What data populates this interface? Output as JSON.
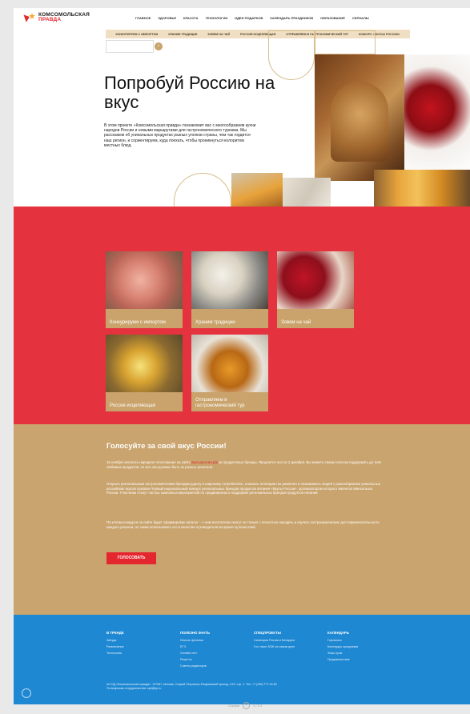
{
  "header": {
    "logo_line1": "Комсомольская",
    "logo_line2": "правда",
    "nav": [
      "Главное",
      "Здоровье",
      "Красота",
      "Технологии",
      "Идеи подарков",
      "Календарь праздников",
      "Образование",
      "Сериалы"
    ],
    "subnav": [
      "Конкурируем с импортом",
      "Храним традиции",
      "Зовем на чай",
      "Россия исцеляющая",
      "Отправляем в гастрономический тур",
      "Конкурс «Вкусы России»"
    ]
  },
  "hero": {
    "title": "Попробуй Россию на вкус",
    "description": "В этом проекте «Комсомольская правда» познакомит вас с многообразием кухни народов России и новыми маршрутами для гастрономического туризма. Мы расскажем об уникальных продуктах разных уголков страны, чем так гордится наш регион, и сориентируем, куда поехать, чтобы проникнуться колоритом местных блюд."
  },
  "cards": [
    {
      "label": "Конкурируем с импортом"
    },
    {
      "label": "Храним традиции"
    },
    {
      "label": "Зовем на чай"
    },
    {
      "label": "Россия исцеляющая"
    },
    {
      "label": "Отправляем в гастрономический тур"
    }
  ],
  "vote": {
    "title": "Голосуйте за свой вкус России!",
    "p1_a": "15 ноября началось народное голосование на сайте ",
    "p1_link": "вкусыроссии.рф",
    "p1_b": " за продуктовые бренды. Продлится оно по 2 декабря. Вы можете своим голосом поддержать до трёх любимых продуктов, но все они должны быть из разных регионов.",
    "p2": "Открыть региональным гастрономическим брендам дорогу в широкому потребителю, показать потенциал их развития и познакомить людей с разнообразием уникальных российских вкусов призван Первый национальный конкурс региональных брендов продуктов питания «Вкусы России», организатором которого является Минсельхоз России. Участники станут частью комплекса мероприятий по продвижению и поддержке региональных брендов продуктов питания.",
    "p3": "По итогам конкурса на сайте будет сформирован каталог – с ним посетители смогут не только с легкостью находить и изучать гастрономические достопримечательности каждого региона, но также использовать его в качестве путеводителя во время путешествий.",
    "button": "ГОЛОСОВАТЬ"
  },
  "footer": {
    "cols": [
      {
        "title": "В тренде",
        "items": [
          "Звёзды",
          "Развлечения",
          "Технологии"
        ]
      },
      {
        "title": "Полезно знать",
        "items": [
          "Личные финансы",
          "ЕГЭ",
          "Онлайн-тест",
          "Рецепты",
          "Советы редакторов"
        ]
      },
      {
        "title": "Спецпроекты",
        "items": [
          "Санатории России и Беларуси",
          "Что такое ЗОЖ на самом деле"
        ]
      },
      {
        "title": "Календарь",
        "items": [
          "Гороскопы",
          "Календарь праздников",
          "Фазы луны",
          "Продовольствие"
        ]
      }
    ],
    "copy1": "АО ИД «Комсомольская правда». 127287, Москва, Старый Петровско-Разумовский проезд, 1/23, стр. 1. Тел. +7 (495) 777-02-82",
    "copy2": "По вопросам сотрудничества: spb@kp.ru"
  },
  "pager": {
    "left": "Ссылки",
    "right": "1 / 2 3"
  }
}
